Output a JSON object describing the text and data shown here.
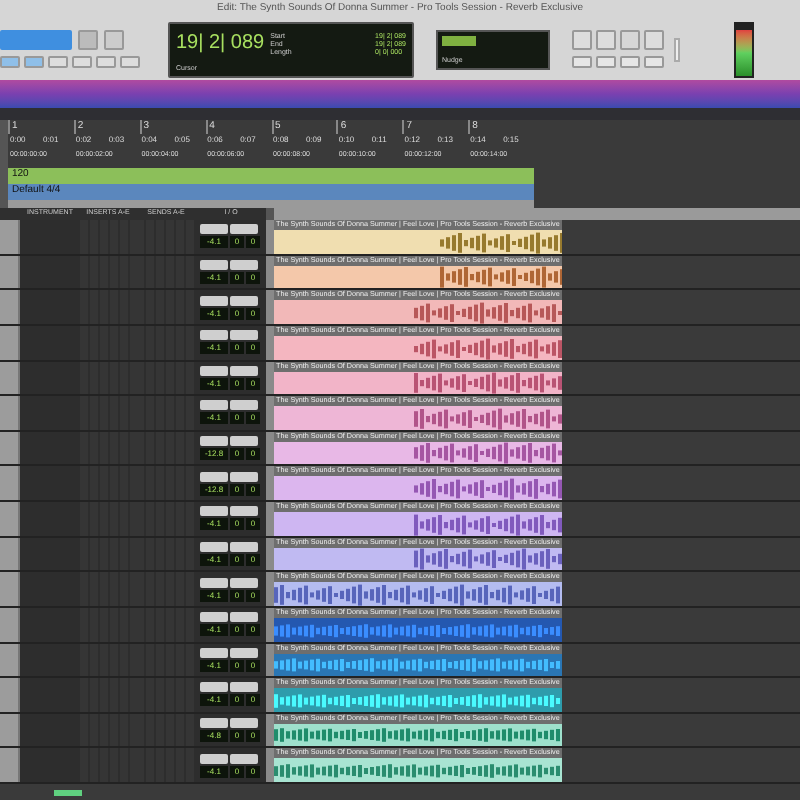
{
  "window": {
    "title": "Edit: The Synth Sounds Of Donna Summer - Pro Tools Session - Reverb Exclusive"
  },
  "counter": {
    "main": "19| 2| 089",
    "start_label": "Start",
    "end_label": "End",
    "length_label": "Length",
    "start": "19| 2| 089",
    "end": "19| 2| 089",
    "length": "0| 0| 000",
    "cursor_label": "Cursor"
  },
  "nudge": {
    "label": "Nudge"
  },
  "ruler": {
    "bars": [
      "1",
      "2",
      "3",
      "4",
      "5",
      "6",
      "7",
      "8"
    ],
    "minsecs": [
      "0:00",
      "0:01",
      "0:02",
      "0:03",
      "0:04",
      "0:05",
      "0:06",
      "0:07",
      "0:08",
      "0:09",
      "0:10",
      "0:11",
      "0:12",
      "0:13",
      "0:14",
      "0:15"
    ],
    "timecode": [
      "00:00:00:00",
      "00:00:02:00",
      "00:00:04:00",
      "00:00:06:00",
      "00:00:08:00",
      "00:00:10:00",
      "00:00:12:00",
      "00:00:14:00"
    ]
  },
  "markers": [
    {
      "label": "120",
      "color": "#8cbf5a"
    },
    {
      "label": "Default 4/4",
      "color": "#5b87bd"
    }
  ],
  "columns": [
    "INSTRUMENT",
    "INSERTS A-E",
    "SENDS A-E",
    "I / O"
  ],
  "tracks": [
    {
      "clip": "The Synth Sounds Of Donna Summer | Feel Love | Pro Tools Session - Reverb Exclusive",
      "volume": "-4.1",
      "pan_l": "0",
      "pan_r": "0",
      "color": "#f0deb0"
    },
    {
      "clip": "The Synth Sounds Of Donna Summer | Feel Love | Pro Tools Session - Reverb Exclusive",
      "volume": "-4.1",
      "pan_l": "0",
      "pan_r": "0",
      "color": "#f4c8aa"
    },
    {
      "clip": "The Synth Sounds Of Donna Summer | Feel Love | Pro Tools Session - Reverb Exclusive",
      "volume": "-4.1",
      "pan_l": "0",
      "pan_r": "0",
      "color": "#f2b8b8"
    },
    {
      "clip": "The Synth Sounds Of Donna Summer | Feel Love | Pro Tools Session - Reverb Exclusive",
      "volume": "-4.1",
      "pan_l": "0",
      "pan_r": "0",
      "color": "#f4b6c0"
    },
    {
      "clip": "The Synth Sounds Of Donna Summer | Feel Love | Pro Tools Session - Reverb Exclusive",
      "volume": "-4.1",
      "pan_l": "0",
      "pan_r": "0",
      "color": "#f2b4c8"
    },
    {
      "clip": "The Synth Sounds Of Donna Summer | Feel Love | Pro Tools Session - Reverb Exclusive",
      "volume": "-4.1",
      "pan_l": "0",
      "pan_r": "0",
      "color": "#eeb6d6"
    },
    {
      "clip": "The Synth Sounds Of Donna Summer | Feel Love | Pro Tools Session - Reverb Exclusive",
      "volume": "-12.8",
      "pan_l": "0",
      "pan_r": "0",
      "color": "#e8b8e6"
    },
    {
      "clip": "The Synth Sounds Of Donna Summer | Feel Love | Pro Tools Session - Reverb Exclusive",
      "volume": "-12.8",
      "pan_l": "0",
      "pan_r": "0",
      "color": "#dcb6ee"
    },
    {
      "clip": "The Synth Sounds Of Donna Summer | Feel Love | Pro Tools Session - Reverb Exclusive",
      "volume": "-4.1",
      "pan_l": "0",
      "pan_r": "0",
      "color": "#ceb6f2"
    },
    {
      "clip": "The Synth Sounds Of Donna Summer | Feel Love | Pro Tools Session - Reverb Exclusive",
      "volume": "-4.1",
      "pan_l": "0",
      "pan_r": "0",
      "color": "#c0baf2"
    },
    {
      "clip": "The Synth Sounds Of Donna Summer | Feel Love | Pro Tools Session - Reverb Exclusive",
      "volume": "-4.1",
      "pan_l": "0",
      "pan_r": "0",
      "color": "#b4bcf0"
    },
    {
      "clip": "The Synth Sounds Of Donna Summer | Feel Love | Pro Tools Session - Reverb Exclusive",
      "volume": "-4.1",
      "pan_l": "0",
      "pan_r": "0",
      "color": "#2458b0"
    },
    {
      "clip": "The Synth Sounds Of Donna Summer | Feel Love | Pro Tools Session - Reverb Exclusive",
      "volume": "-4.1",
      "pan_l": "0",
      "pan_r": "0",
      "color": "#2a76b4"
    },
    {
      "clip": "The Synth Sounds Of Donna Summer | Feel Love | Pro Tools Session - Reverb Exclusive",
      "volume": "-4.1",
      "pan_l": "0",
      "pan_r": "0",
      "color": "#2e9cac"
    },
    {
      "clip": "The Synth Sounds Of Donna Summer | Feel Love | Pro Tools Session - Reverb Exclusive",
      "volume": "-4.8",
      "pan_l": "0",
      "pan_r": "0",
      "color": "#9ee0cc"
    },
    {
      "clip": "The Synth Sounds Of Donna Summer | Feel Love | Pro Tools Session - Reverb Exclusive",
      "volume": "-4.1",
      "pan_l": "0",
      "pan_r": "0",
      "color": "#a8e4d2"
    }
  ]
}
